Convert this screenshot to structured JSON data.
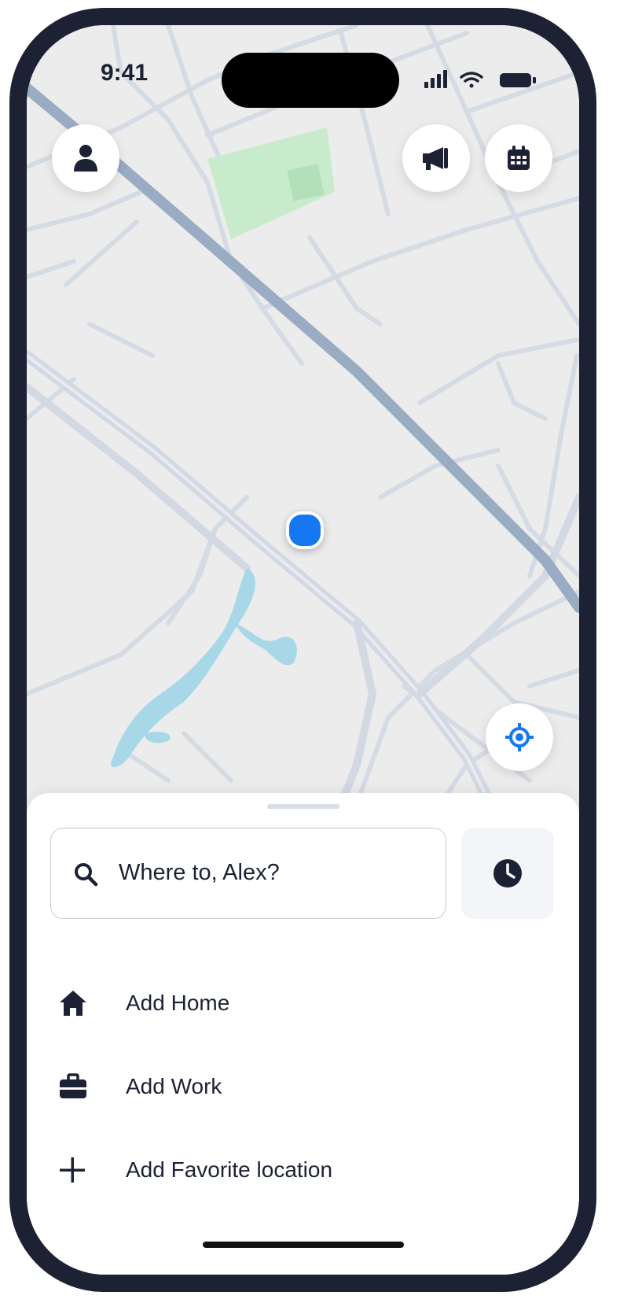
{
  "status_bar": {
    "time": "9:41"
  },
  "map": {
    "buttons": {
      "profile_icon": "user-icon",
      "announcement_icon": "megaphone-icon",
      "calendar_icon": "calendar-icon",
      "locate_icon": "crosshair-icon"
    },
    "colors": {
      "background": "#ececec",
      "road": "#d5dbe4",
      "highway": "#9aabc4",
      "park": "#c8ebcc",
      "water": "#a8d8e8",
      "location_dot": "#1677f2",
      "accent": "#1677f2"
    }
  },
  "sheet": {
    "search": {
      "placeholder": "Where to, Alex?"
    },
    "recent_icon": "clock-icon",
    "items": [
      {
        "label": "Add Home",
        "icon": "home-icon"
      },
      {
        "label": "Add Work",
        "icon": "briefcase-icon"
      },
      {
        "label": "Add Favorite location",
        "icon": "plus-icon"
      }
    ]
  }
}
